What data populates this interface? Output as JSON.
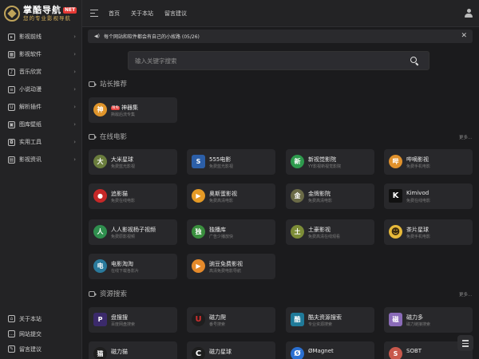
{
  "logo": {
    "title": "掌酷导航",
    "badge": "NET",
    "subtitle": "您的专业影视导航"
  },
  "sidebar": {
    "items": [
      {
        "label": "影视前线",
        "icon": "play-square-icon"
      },
      {
        "label": "影视软件",
        "icon": "grid-icon"
      },
      {
        "label": "音乐欣赏",
        "icon": "music-note-icon"
      },
      {
        "label": "小说动漫",
        "icon": "book-icon"
      },
      {
        "label": "解析插件",
        "icon": "plugin-icon"
      },
      {
        "label": "图库壁纸",
        "icon": "image-icon"
      },
      {
        "label": "实用工具",
        "icon": "toolbox-icon"
      },
      {
        "label": "影视资讯",
        "icon": "news-icon"
      }
    ],
    "bottom": [
      {
        "label": "关于本站",
        "icon": "home-icon"
      },
      {
        "label": "网站提交",
        "icon": "chat-icon"
      },
      {
        "label": "留言建议",
        "icon": "feedback-icon"
      }
    ]
  },
  "header": {
    "nav": [
      "首页",
      "关于本站",
      "留言建议"
    ]
  },
  "notice": {
    "text": "每个网站和软件都会有自己的小故路 (05/26)"
  },
  "search": {
    "placeholder": "输入关键字搜索"
  },
  "sections": {
    "recommend": {
      "title": "站长推荐",
      "cards": [
        {
          "name": "神器集",
          "badge": "限免",
          "desc": "撕敌后流专集",
          "logo": "神",
          "color": "#e0952b"
        }
      ]
    },
    "online": {
      "title": "在线电影",
      "more": "更多...",
      "cards": [
        {
          "name": "大米星球",
          "desc": "免费蓝光影视",
          "logo": "大",
          "color": "#6a7d3d"
        },
        {
          "name": "555电影",
          "desc": "免费蓝光影视",
          "logo": "S",
          "color": "#2c5fa8"
        },
        {
          "name": "新视觉影院",
          "desc": "YY影视新视觉影院",
          "logo": "新",
          "color": "#2e9a4d"
        },
        {
          "name": "哔嘀影视",
          "desc": "免费手机电影",
          "logo": "哔",
          "color": "#e0912c"
        },
        {
          "name": "追影猫",
          "desc": "免费在线电影",
          "logo": "●",
          "color": "#c62828"
        },
        {
          "name": "奥斯蛋影视",
          "desc": "免费高清电影",
          "logo": "▶",
          "color": "#e59a26"
        },
        {
          "name": "金牌影院",
          "desc": "免费高清电影",
          "logo": "金",
          "color": "#6b6b47"
        },
        {
          "name": "Kimivod",
          "desc": "免费在线电影",
          "logo": "K",
          "color": "#111111"
        },
        {
          "name": "人人影视杨子视频",
          "desc": "免费原影视频",
          "logo": "人",
          "color": "#2f8f4e"
        },
        {
          "name": "独播库",
          "desc": "广告少播放快",
          "logo": "独",
          "color": "#3a8f3e"
        },
        {
          "name": "土豪影视",
          "desc": "免费高清在线观看",
          "logo": "土",
          "color": "#7c8c37"
        },
        {
          "name": "茶片星球",
          "desc": "免费手机电影",
          "logo": "☻",
          "color": "#e7b93a"
        },
        {
          "name": "电影淘淘",
          "desc": "在线下载各影片",
          "logo": "电",
          "color": "#2a7a9c"
        },
        {
          "name": "豌豆免费影视",
          "desc": "高清免费电影导航",
          "logo": "▶",
          "color": "#e58a2b"
        }
      ]
    },
    "resource": {
      "title": "资源搜索",
      "more": "更多...",
      "cards": [
        {
          "name": "盘搜搜",
          "desc": "百度网盘搜索",
          "logo": "P",
          "color": "#3b2a6b"
        },
        {
          "name": "磁力爬",
          "desc": "番号搜索",
          "logo": "U",
          "color": "#1e1e1e"
        },
        {
          "name": "酷夫资源搜索",
          "desc": "专业资源搜索",
          "logo": "酷",
          "color": "#1f7a99"
        },
        {
          "name": "磁力多",
          "desc": "磁力链接搜索",
          "logo": "磁",
          "color": "#8a6bb8"
        },
        {
          "name": "磁力猫",
          "desc": "",
          "logo": "猫",
          "color": "#1e1e1e"
        },
        {
          "name": "磁力星球",
          "desc": "",
          "logo": "C",
          "color": "#1e1e1e"
        },
        {
          "name": "ØMagnet",
          "desc": "",
          "logo": "Ø",
          "color": "#2a6fd1"
        },
        {
          "name": "SOBT",
          "desc": "",
          "logo": "S",
          "color": "#c8584c"
        }
      ]
    }
  }
}
